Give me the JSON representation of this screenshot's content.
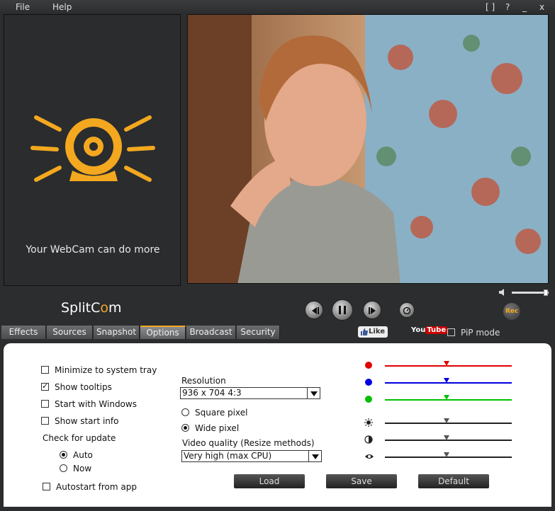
{
  "menu": {
    "file": "File",
    "help": "Help"
  },
  "window_controls": {
    "fullscreen": "[ ]",
    "help": "?",
    "minimize": "_",
    "close": "x"
  },
  "promo": {
    "text": "Your WebCam can do more",
    "icon": "webcam-icon"
  },
  "logo": {
    "prefix": "Split",
    "suffix": "m"
  },
  "player": {
    "rec_label": "Rec"
  },
  "tabs": [
    {
      "label": "Effects"
    },
    {
      "label": "Sources"
    },
    {
      "label": "Snapshot"
    },
    {
      "label": "Options"
    },
    {
      "label": "Broadcast"
    },
    {
      "label": "Security"
    }
  ],
  "active_tab": "Options",
  "social": {
    "like": "Like",
    "youtube_you": "You",
    "youtube_tube": "Tube",
    "pip_label": "PiP mode"
  },
  "options": {
    "minimize_tray": {
      "label": "Minimize to system tray",
      "checked": false
    },
    "show_tooltips": {
      "label": "Show tooltips",
      "checked": true
    },
    "start_windows": {
      "label": "Start with Windows",
      "checked": false
    },
    "show_start_info": {
      "label": "Show start info",
      "checked": false
    },
    "check_update_label": "Check for update",
    "update_auto": {
      "label": "Auto",
      "selected": true
    },
    "update_now": {
      "label": "Now",
      "selected": false
    },
    "autostart": {
      "label": "Autostart from app",
      "checked": false
    }
  },
  "resolution": {
    "label": "Resolution",
    "value": "936 x 704   4:3",
    "square_pixel": {
      "label": "Square pixel",
      "selected": false
    },
    "wide_pixel": {
      "label": "Wide pixel",
      "selected": true
    },
    "quality_label": "Video quality (Resize methods)",
    "quality_value": "Very high (max CPU)"
  },
  "adjustments": [
    {
      "name": "red",
      "icon": "red-dot-icon",
      "color": "#e00000",
      "level": 0.49
    },
    {
      "name": "blue",
      "icon": "blue-dot-icon",
      "color": "#0000e0",
      "level": 0.49
    },
    {
      "name": "green",
      "icon": "green-dot-icon",
      "color": "#00c000",
      "level": 0.49
    },
    {
      "name": "brightness",
      "icon": "brightness-icon",
      "color": "#222222",
      "level": 0.49
    },
    {
      "name": "contrast",
      "icon": "contrast-icon",
      "color": "#222222",
      "level": 0.49
    },
    {
      "name": "saturation",
      "icon": "eye-icon",
      "color": "#222222",
      "level": 0.49
    }
  ],
  "volume_level": 0.9,
  "actions": {
    "load": "Load",
    "save": "Save",
    "default": "Default"
  },
  "colors": {
    "accent": "#f3a81f",
    "background": "#2b2d2f"
  }
}
